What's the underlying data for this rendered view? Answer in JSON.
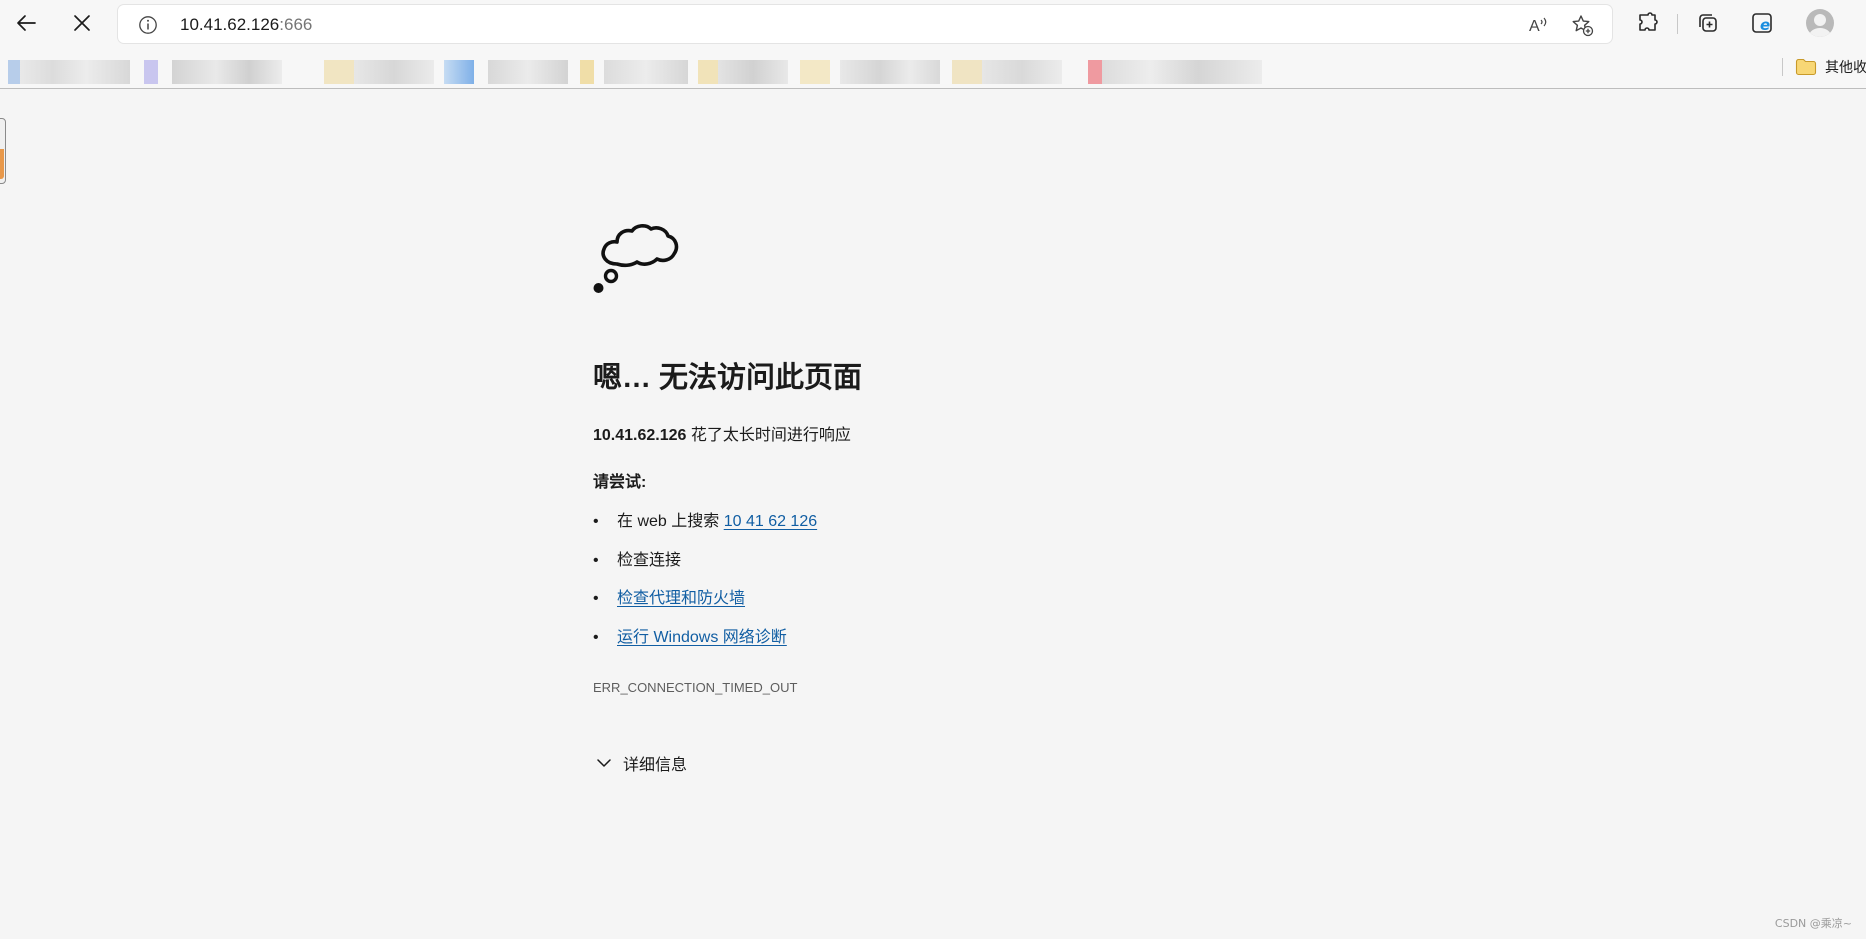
{
  "toolbar": {
    "back_icon": "arrow-left-icon",
    "stop_icon": "close-icon",
    "address": {
      "info_icon": "info-circle-icon",
      "url_host": "10.41.62.126",
      "url_port": ":666",
      "read_aloud_icon": "read-aloud-icon",
      "add_favorite_icon": "star-add-icon"
    },
    "extensions_icon": "puzzle-icon",
    "collections_icon": "collections-icon",
    "ie_mode_icon": "ie-mode-icon",
    "profile_icon": "avatar-icon"
  },
  "favorites": {
    "other_label": "其他收"
  },
  "error": {
    "icon": "thought-cloud-icon",
    "title": "嗯… 无法访问此页面",
    "host": "10.41.62.126",
    "message": " 花了太长时间进行响应",
    "try_label": "请尝试:",
    "suggestions": [
      {
        "prefix": "在 web 上搜索 ",
        "link": "10 41 62 126"
      },
      {
        "text": "检查连接"
      },
      {
        "link": "检查代理和防火墙"
      },
      {
        "link": "运行 Windows 网络诊断"
      }
    ],
    "error_code": "ERR_CONNECTION_TIMED_OUT",
    "details_label": "详细信息"
  },
  "watermark": "CSDN @乘凉~",
  "colors": {
    "page_bg": "#f5f5f5",
    "link": "#115ea3",
    "text": "#1b1b1b",
    "muted": "#5d5d5d"
  }
}
